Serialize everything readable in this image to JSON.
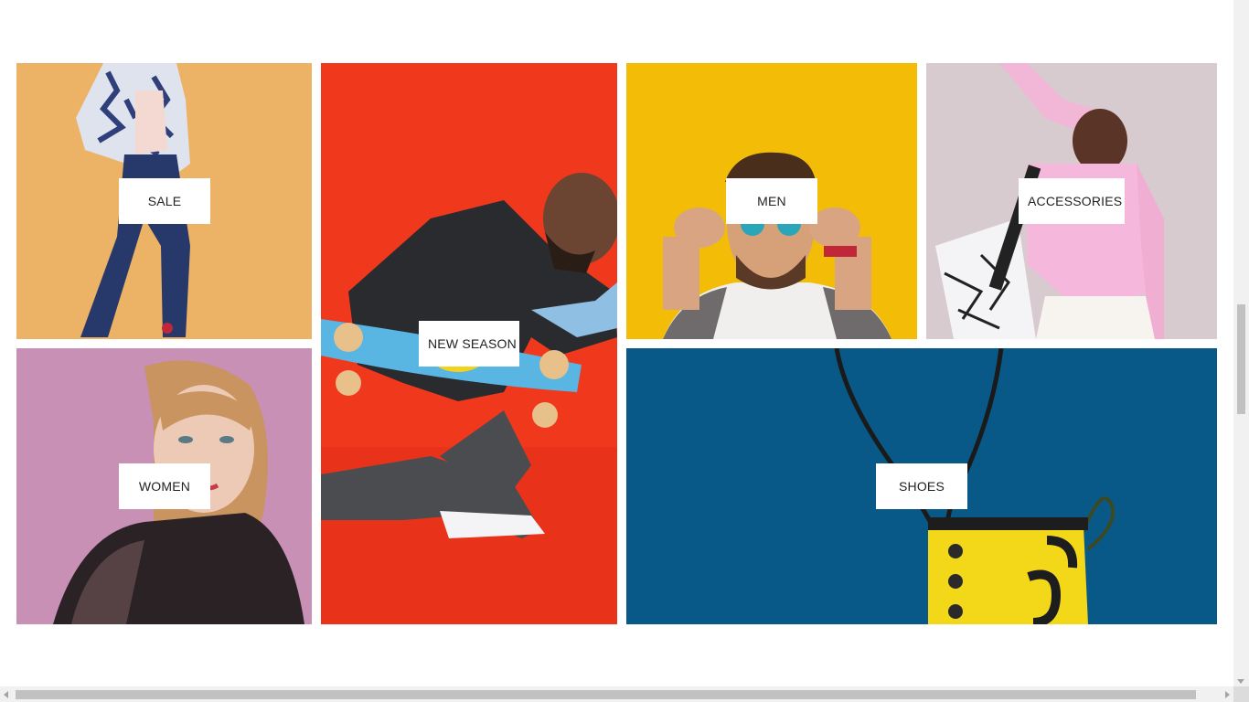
{
  "categories": {
    "sale": {
      "label": "SALE",
      "image": "woman-in-floral-jacket-photo",
      "background": "#e9ae61"
    },
    "new_season": {
      "label": "NEW SEASON",
      "image": "man-with-skateboard-photo",
      "background": "#f0381c"
    },
    "men": {
      "label": "MEN",
      "image": "man-with-sunglasses-photo",
      "background": "#f7c10a"
    },
    "accessories": {
      "label": "ACCESSORIES",
      "image": "woman-in-pink-top-photo",
      "background": "#d8cbd0"
    },
    "women": {
      "label": "WOMEN",
      "image": "woman-with-black-scarf-photo",
      "background": "#c790b4"
    },
    "shoes": {
      "label": "SHOES",
      "image": "yellow-boot-photo",
      "background": "#0a5d8e"
    }
  },
  "colors": {
    "label_background": "#ffffff",
    "label_text": "#222222",
    "scrollbar_track": "#f1f1f1",
    "scrollbar_thumb": "#c1c1c1"
  }
}
